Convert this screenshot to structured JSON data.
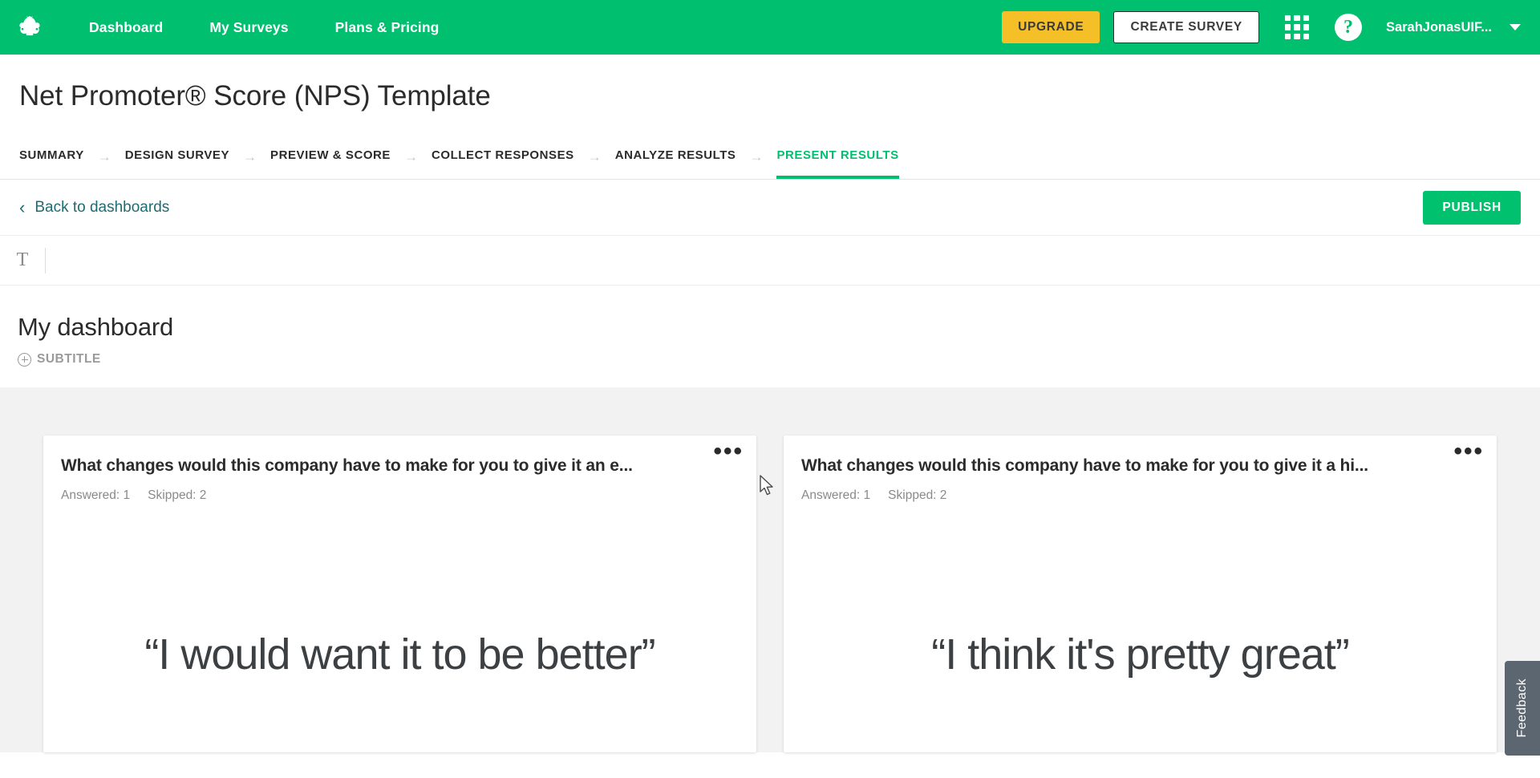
{
  "topnav": {
    "logo_icon": "surveymonkey-logo-icon",
    "links": [
      {
        "label": "Dashboard"
      },
      {
        "label": "My Surveys"
      },
      {
        "label": "Plans & Pricing"
      }
    ],
    "upgrade_label": "UPGRADE",
    "create_survey_label": "CREATE SURVEY",
    "apps_icon": "grid-apps-icon",
    "help_icon": "help-question-icon",
    "account_label": "SarahJonasUIF...",
    "caret_icon": "chevron-down-icon",
    "bg_color": "#00bf6f",
    "upgrade_color": "#f5bf28"
  },
  "survey": {
    "title": "Net Promoter® Score (NPS) Template"
  },
  "tabs": {
    "separator": "→",
    "items": [
      {
        "label": "SUMMARY",
        "active": false
      },
      {
        "label": "DESIGN SURVEY",
        "active": false
      },
      {
        "label": "PREVIEW & SCORE",
        "active": false
      },
      {
        "label": "COLLECT RESPONSES",
        "active": false
      },
      {
        "label": "ANALYZE RESULTS",
        "active": false
      },
      {
        "label": "PRESENT RESULTS",
        "active": true
      }
    ],
    "active_color": "#00bf6f"
  },
  "actionbar": {
    "back_chevron": "‹",
    "back_label": "Back to dashboards",
    "publish_label": "PUBLISH",
    "publish_color": "#00c16e",
    "back_link_color": "#1f6b72"
  },
  "toolbar": {
    "text_tool_glyph": "T",
    "text_tool_name": "text-tool-icon"
  },
  "dashboard": {
    "title": "My dashboard",
    "subtitle_label": "SUBTITLE",
    "add_icon": "plus-circle-icon"
  },
  "cards": [
    {
      "title": "What changes would this company have to make for you to give it an e...",
      "answered_label": "Answered: 1",
      "skipped_label": "Skipped: 2",
      "menu_icon": "more-options-icon",
      "menu_glyph": "•••",
      "quote": "“I would want it to be better”"
    },
    {
      "title": "What changes would this company have to make for you to give it a hi...",
      "answered_label": "Answered: 1",
      "skipped_label": "Skipped: 2",
      "menu_icon": "more-options-icon",
      "menu_glyph": "•••",
      "quote": "“I think it's pretty great”"
    }
  ],
  "feedback": {
    "label": "Feedback",
    "bg_color": "#5c6670"
  }
}
